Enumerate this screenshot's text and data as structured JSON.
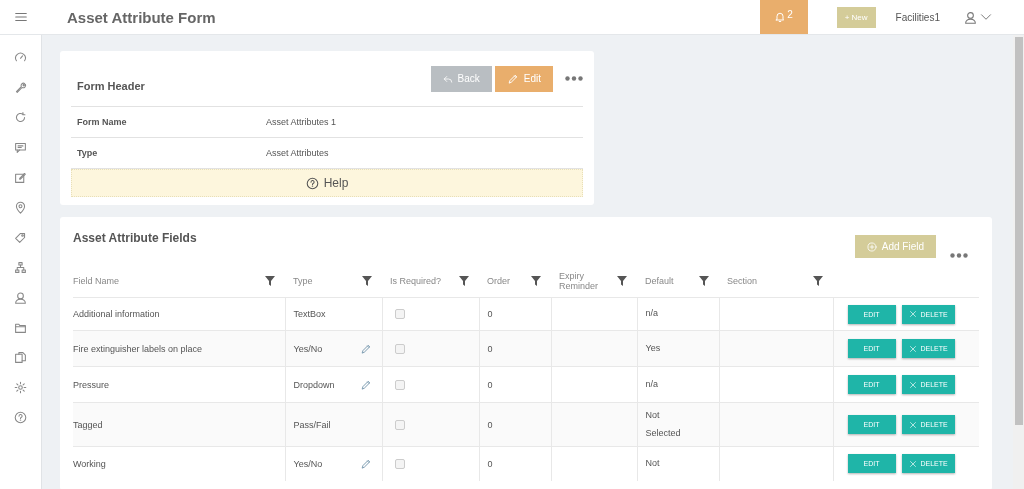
{
  "header": {
    "title": "Asset Attribute Form",
    "notification_count": "2",
    "new_button": "+ New",
    "user": "Facilities1"
  },
  "form_header": {
    "title": "Form Header",
    "back_button": "Back",
    "edit_button": "Edit",
    "rows": [
      {
        "label": "Form Name",
        "value": "Asset Attributes 1"
      },
      {
        "label": "Type",
        "value": "Asset Attributes"
      }
    ],
    "help": "Help"
  },
  "fields_table": {
    "title": "Asset Attribute Fields",
    "add_button": "Add Field",
    "columns": [
      "Field Name",
      "Type",
      "Is Required?",
      "Order",
      "Expiry Reminder",
      "Default",
      "Section"
    ],
    "rows": [
      {
        "field_name": "Additional information",
        "type": "TextBox",
        "type_editable": false,
        "required": false,
        "order": "0",
        "default": "n/a",
        "edit": "EDIT",
        "delete": "DELETE"
      },
      {
        "field_name": "Fire extinguisher labels on place",
        "type": "Yes/No",
        "type_editable": true,
        "required": false,
        "order": "0",
        "default": "Yes",
        "edit": "EDIT",
        "delete": "DELETE"
      },
      {
        "field_name": "Pressure",
        "type": "Dropdown",
        "type_editable": true,
        "required": false,
        "order": "0",
        "default": "n/a",
        "edit": "EDIT",
        "delete": "DELETE"
      },
      {
        "field_name": "Tagged",
        "type": "Pass/Fail",
        "type_editable": false,
        "required": false,
        "order": "0",
        "default": "Not Selected",
        "edit": "EDIT",
        "delete": "DELETE"
      },
      {
        "field_name": "Working",
        "type": "Yes/No",
        "type_editable": true,
        "required": false,
        "order": "0",
        "default": "Not",
        "edit": "EDIT",
        "delete": "DELETE"
      }
    ]
  }
}
